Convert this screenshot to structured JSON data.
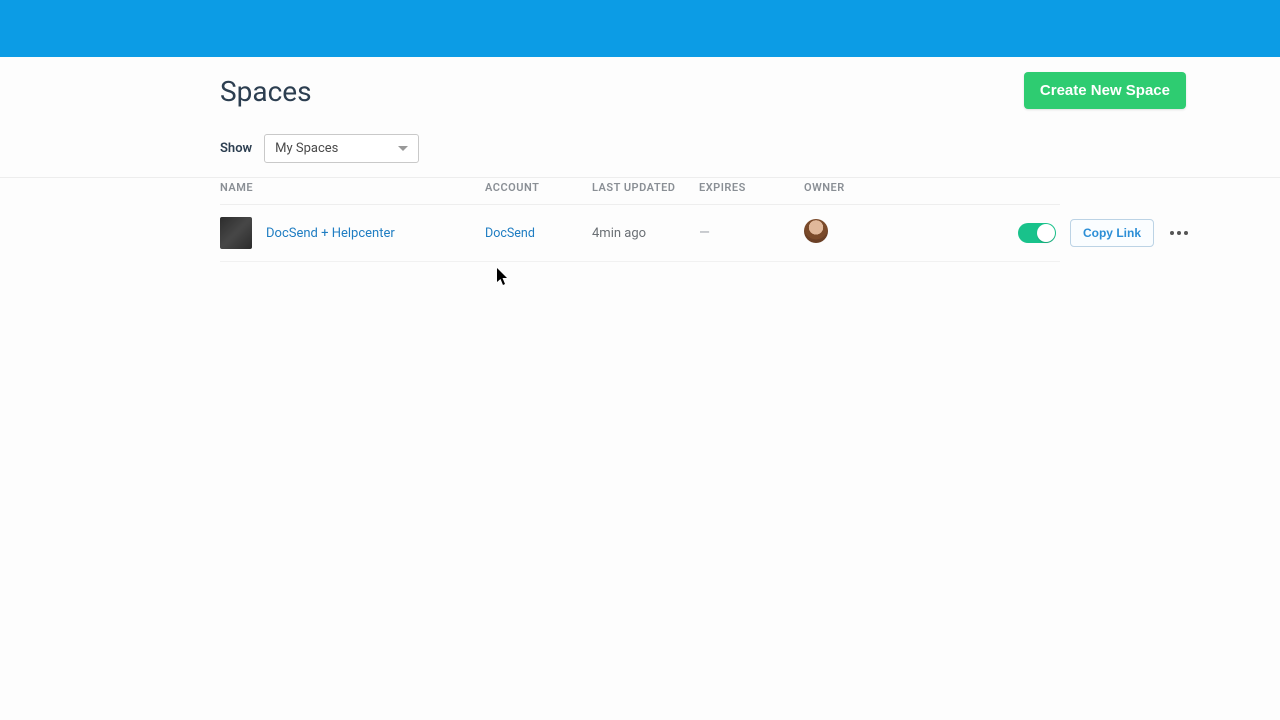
{
  "header": {
    "title": "Spaces",
    "create_button": "Create New Space"
  },
  "filter": {
    "label": "Show",
    "selected": "My Spaces"
  },
  "columns": {
    "name": "NAME",
    "account": "ACCOUNT",
    "last_updated": "LAST UPDATED",
    "expires": "EXPIRES",
    "owner": "OWNER"
  },
  "rows": [
    {
      "name": "DocSend + Helpcenter",
      "account": "DocSend",
      "last_updated": "4min ago",
      "expires": "—",
      "toggle_on": true,
      "copy_link_label": "Copy Link"
    }
  ]
}
